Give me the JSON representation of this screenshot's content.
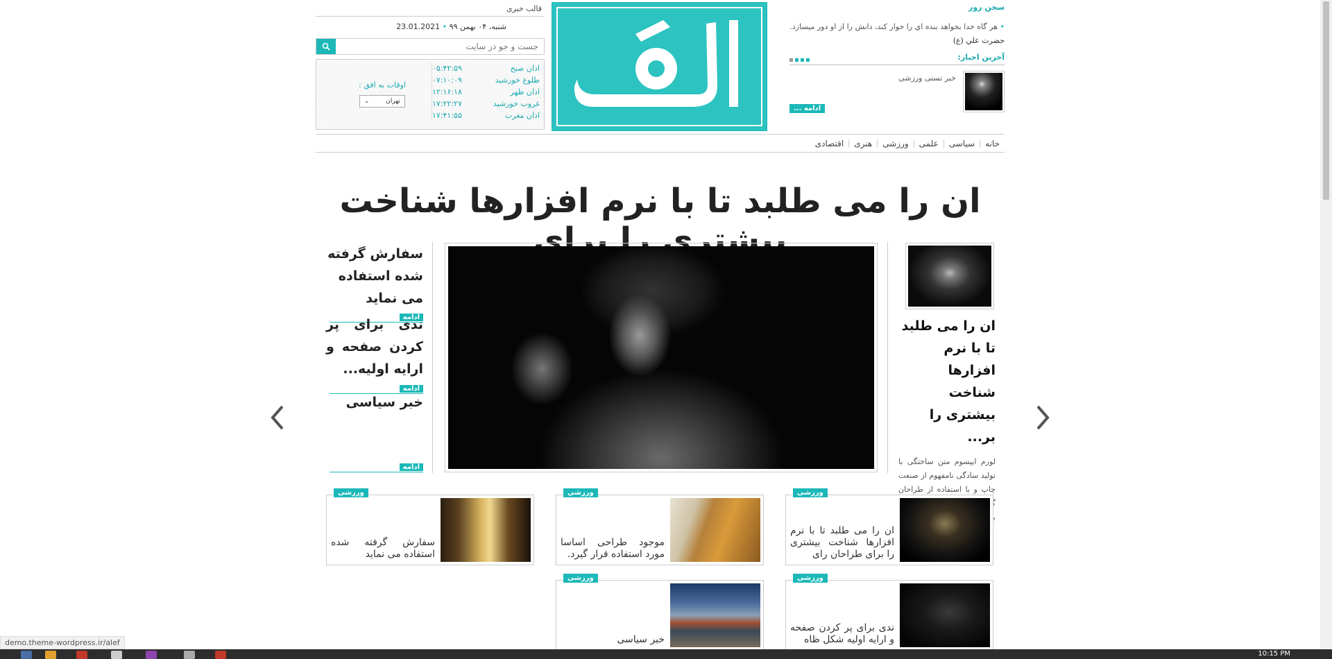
{
  "header": {
    "quote_title": "سخن روز",
    "quote_text": "هر گاه خدا بخواهد بنده اي را خوار كند، دانش را از او دور ميسازد.",
    "quote_author": "حضرت علي (ع)",
    "latest_title": "آخرین اخبار:",
    "latest_item": "خبر تستی ورزشی",
    "latest_more": "ادامه ...",
    "site_name": "قالب خبری",
    "date_persian": "شنبه، ۰۴ بهمن ۹۹",
    "date_gregorian": "23.01.2021",
    "search_placeholder": "جست و جو در سایت",
    "horizon_label": "اوقات به افق :",
    "city": "تهران",
    "prayer": [
      {
        "name": "اذان صبح",
        "time": "۰۵:۴۲:۵۹"
      },
      {
        "name": "طلوع خورشید",
        "time": "۰۷:۱۰:۰۹"
      },
      {
        "name": "اذان ظهر",
        "time": "۱۲:۱۶:۱۸"
      },
      {
        "name": "غروب خورشید",
        "time": "۱۷:۲۲:۲۷"
      },
      {
        "name": "اذان مغرب",
        "time": "۱۷:۴۱:۵۵"
      }
    ],
    "logo_text": "الف"
  },
  "nav": [
    "خانه",
    "سیاسی",
    "علمی",
    "ورزشی",
    "هنری",
    "اقتصادی"
  ],
  "headline": "ان را می طلبد تا با نرم افزارها شناخت بیشتری را برای",
  "slider": {
    "right_title": "ان را می طلبد تا با نرم افزارها شناخت بیشتری را بر...",
    "right_text": "لورم ایپسوم متن ساختگی با تولید سادگی نامفهوم از صنعت چاپ و با استفاده از طراحان گرافیک است. چاپگرها و متون بلکه روزنامه و مجله در",
    "left_items": [
      {
        "title": "سفارش گرفته شده استفاده می نماید",
        "more": "ادامه"
      },
      {
        "title": "ندی برای پر کردن صفحه و ارایه اولیه...",
        "more": "ادامه"
      },
      {
        "title": "خبر سیاسی",
        "more": "ادامه"
      }
    ]
  },
  "cards": [
    {
      "tag": "ورزشی",
      "text": "ان را می طلبد تا با نرم افزارها شناخت بیشتری را برای طراحان رای"
    },
    {
      "tag": "ورزشی",
      "text": "موجود طراحی اساسا مورد استفاده قرار گیرد."
    },
    {
      "tag": "ورزشی",
      "text": "سفارش گرفته شده استفاده می نماید"
    },
    {
      "tag": "ورزشی",
      "text": "ندی برای پر کردن صفحه و ارایه اولیه شکل ظاه"
    },
    {
      "tag": "ورزشی",
      "text": "خبر سیاسی"
    }
  ],
  "status_url": "demo.theme-wordpress.ir/alef",
  "clock": "10:15 PM",
  "colors": {
    "accent": "#1cb8b8",
    "logo_bg": "#2cc3c0"
  }
}
